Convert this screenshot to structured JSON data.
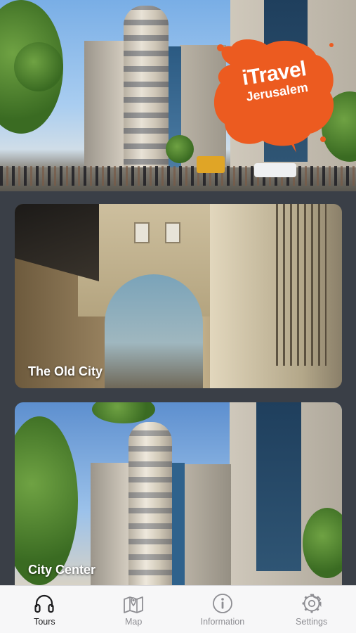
{
  "logo": {
    "brand": "iTravel",
    "city": "Jerusalem",
    "color": "#ec5b20"
  },
  "tours": [
    {
      "title": "The Old City"
    },
    {
      "title": "City Center"
    }
  ],
  "tabbar": {
    "items": [
      {
        "label": "Tours",
        "icon": "headphones-icon",
        "active": true
      },
      {
        "label": "Map",
        "icon": "map-pin-icon",
        "active": false
      },
      {
        "label": "Information",
        "icon": "info-icon",
        "active": false
      },
      {
        "label": "Settings",
        "icon": "gear-icon",
        "active": false
      }
    ],
    "active_color": "#1c1c1e",
    "inactive_color": "#8e8e93"
  }
}
